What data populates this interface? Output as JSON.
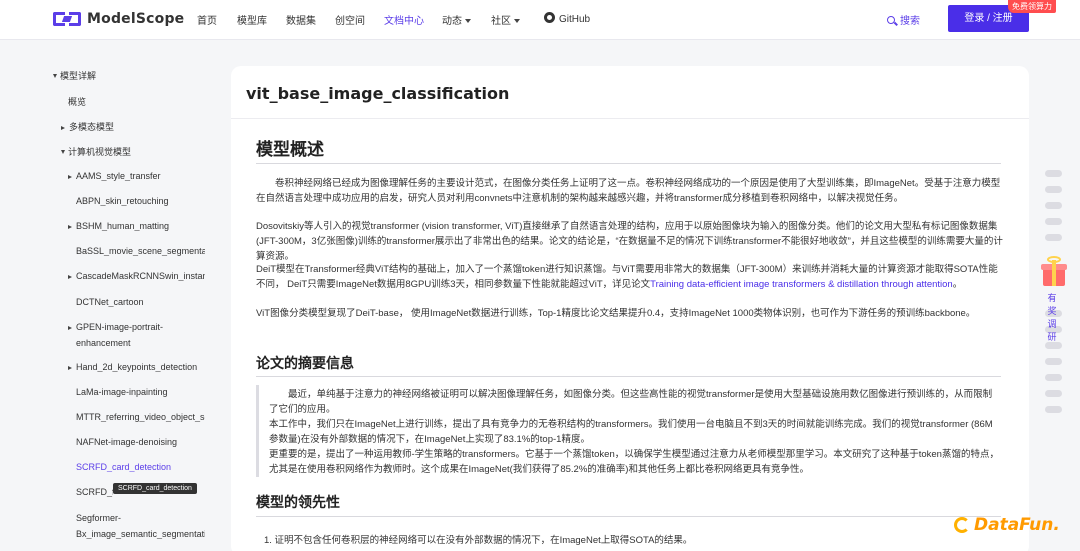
{
  "nav": {
    "logo_text": "ModelScope",
    "items": [
      {
        "label": "首页",
        "active": false,
        "caret": false
      },
      {
        "label": "模型库",
        "active": false,
        "caret": false
      },
      {
        "label": "数据集",
        "active": false,
        "caret": false
      },
      {
        "label": "创空间",
        "active": false,
        "caret": false
      },
      {
        "label": "文档中心",
        "active": true,
        "caret": false
      },
      {
        "label": "动态",
        "active": false,
        "caret": true
      },
      {
        "label": "社区",
        "active": false,
        "caret": true
      }
    ],
    "github_label": "GitHub",
    "search_label": "搜索",
    "login_label": "登录 / 注册",
    "free_badge": "免费领算力",
    "accent_color": "#5b3ee8"
  },
  "sidebar": {
    "items": [
      {
        "label": "模型详解",
        "icon": "caret-down"
      },
      {
        "label": "概览",
        "icon": ""
      },
      {
        "label": "多模态模型",
        "icon": "caret-right"
      },
      {
        "label": "计算机视觉模型",
        "icon": "caret-down"
      },
      {
        "label": "AAMS_style_transfer",
        "icon": "caret-right"
      },
      {
        "label": "ABPN_skin_retouching",
        "icon": ""
      },
      {
        "label": "BSHM_human_matting",
        "icon": "caret-right"
      },
      {
        "label": "BaSSL_movie_scene_segmentation",
        "icon": ""
      },
      {
        "label": "CascadeMaskRCNNSwin_instance",
        "icon": "caret-right"
      },
      {
        "label": "DCTNet_cartoon",
        "icon": ""
      },
      {
        "label": "GPEN-image-portrait-",
        "label2": "enhancement",
        "icon": "caret-right"
      },
      {
        "label": "Hand_2d_keypoints_detection",
        "icon": "caret-right"
      },
      {
        "label": "LaMa-image-inpainting",
        "icon": ""
      },
      {
        "label": "MTTR_referring_video_object_segmentation",
        "icon": ""
      },
      {
        "label": "NAFNet-image-denoising",
        "icon": ""
      },
      {
        "label": "SCRFD_card_detection",
        "icon": "",
        "link": true
      },
      {
        "label": "SCRFD_face_detection",
        "icon": ""
      },
      {
        "label": "Segformer-",
        "label2": "Bx_image_semantic_segmentation",
        "icon": ""
      }
    ],
    "tooltip": "SCRFD_card_detection"
  },
  "content": {
    "doc_title": "vit_base_image_classification",
    "section1_title": "模型概述",
    "section1_paragraphs": [
      "卷积神经网络已经成为图像理解任务的主要设计范式，在图像分类任务上证明了这一点。卷积神经网络成功的一个原因是使用了大型训练集，即ImageNet。受基于注意力模型在自然语言处理中成功应用的启发，研究人员对利用convnets中注意机制的架构越来越感兴趣，并将transformer成分移植到卷积网络中，以解决视觉任务。",
      "Dosovitskiy等人引入的视觉transformer (vision transformer, ViT)直接继承了自然语言处理的结构，应用于以原始图像块为输入的图像分类。他们的论文用大型私有标记图像数据集(JFT-300M，3亿张图像)训练的transformer展示出了非常出色的结果。论文的结论是，“在数据量不足的情况下训练transformer不能很好地收敛”，并且这些模型的训练需要大量的计算资源。",
      "DeiT模型在Transformer经典ViT结构的基础上，加入了一个蒸馏token进行知识蒸馏。与ViT需要用非常大的数据集（JFT-300M）来训练并消耗大量的计算资源才能取得SOTA性能不同， DeiT只需要ImageNet数据用8GPU训练3天，相同参数量下性能就能超过ViT，详见论文",
      "Training data-efficient image transformers & distillation through attention",
      "ViT图像分类模型复现了DeiT-base， 使用ImageNet数据进行训练，Top-1精度比论文结果提升0.4，支持ImageNet 1000类物体识别，也可作为下游任务的预训练backbone。"
    ],
    "section2_title": "论文的摘要信息",
    "section2_quote": [
      "最近，单纯基于注意力的神经网络被证明可以解决图像理解任务，如图像分类。但这些高性能的视觉transformer是使用大型基础设施用数亿图像进行预训练的，从而限制了它们的应用。",
      "本工作中，我们只在ImageNet上进行训练，提出了具有竞争力的无卷积结构的transformers。我们使用一台电脑且不到3天的时间就能训练完成。我们的视觉transformer (86M参数量)在没有外部数据的情况下，在ImageNet上实现了83.1%的top-1精度。",
      "更重要的是，提出了一种运用教师-学生策略的transformers。它基于一个蒸馏token，以确保学生模型通过注意力从老师模型那里学习。本文研究了这种基于token蒸馏的特点，尤其是在使用卷积网络作为教师时。这个成果在ImageNet(我们获得了85.2%的准确率)和其他任务上都比卷积网络更具有竞争性。"
    ],
    "section3_title": "模型的领先性",
    "section3_item": "1. 证明不包含任何卷积层的神经网络可以在没有外部数据的情况下，在ImageNet上取得SOTA的结果。"
  },
  "right_rail": {
    "survey_text": "有奖调研"
  },
  "watermark": {
    "text": "DataFun."
  }
}
